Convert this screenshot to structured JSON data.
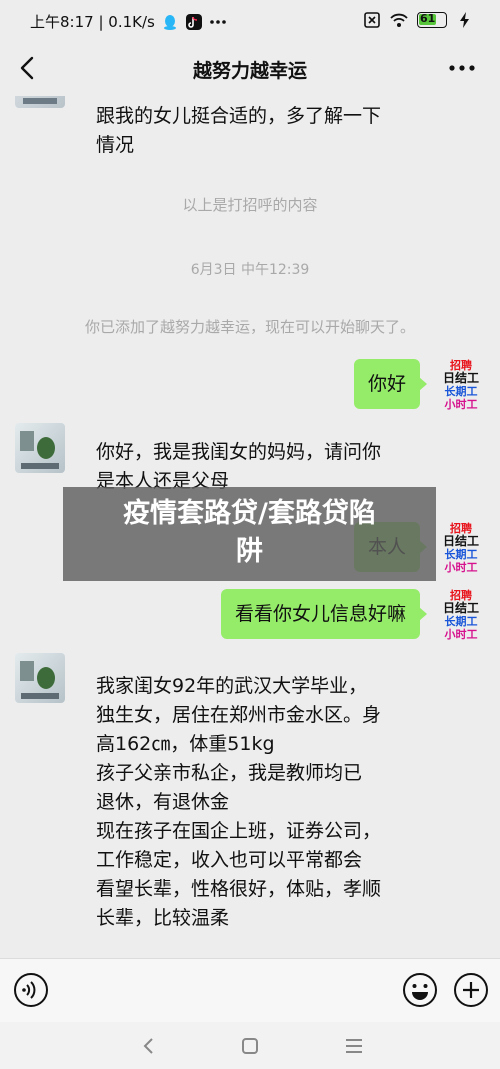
{
  "statusbar": {
    "time_speed": "上午8:17 | 0.1K/s",
    "battery": "61",
    "icons": [
      "qq-icon",
      "tiktok-icon",
      "more-dots-icon",
      "no-sim-icon",
      "wifi-icon",
      "battery-icon",
      "charging-icon"
    ]
  },
  "header": {
    "title": "越努力越幸运"
  },
  "messages": {
    "m1": [
      "跟我的女儿挺合适的，多了解一下",
      "情况"
    ],
    "sys1": "以上是打招呼的内容",
    "time1": "6月3日 中午12:39",
    "sys2": "你已添加了越努力越幸运，现在可以开始聊天了。",
    "r1": "你好",
    "m2": [
      "你好，我是我闺女的妈妈，请问你",
      "是本人还是父母"
    ],
    "r2": "本人",
    "r3": "看看你女儿信息好嘛",
    "m3": [
      "我家闺女92年的武汉大学毕业，",
      "独生女，居住在郑州市金水区。身",
      "高162㎝，体重51kg",
      "孩子父亲市私企，我是教师均已",
      "退休，有退休金",
      "现在孩子在国企上班，证券公司，",
      "工作稳定，收入也可以平常都会",
      "看望长辈，性格很好，体贴，孝顺",
      "长辈，比较温柔"
    ]
  },
  "self_avatar": {
    "l1": "招聘",
    "l2": "日结工",
    "l3": "长期工",
    "l4": "小时工"
  },
  "watermark": [
    "疫情套路贷/套路贷陷",
    "阱"
  ],
  "colors": {
    "bg": "#ededed",
    "bubble_me": "#95ec69",
    "bubble_other": "#ffffff"
  }
}
